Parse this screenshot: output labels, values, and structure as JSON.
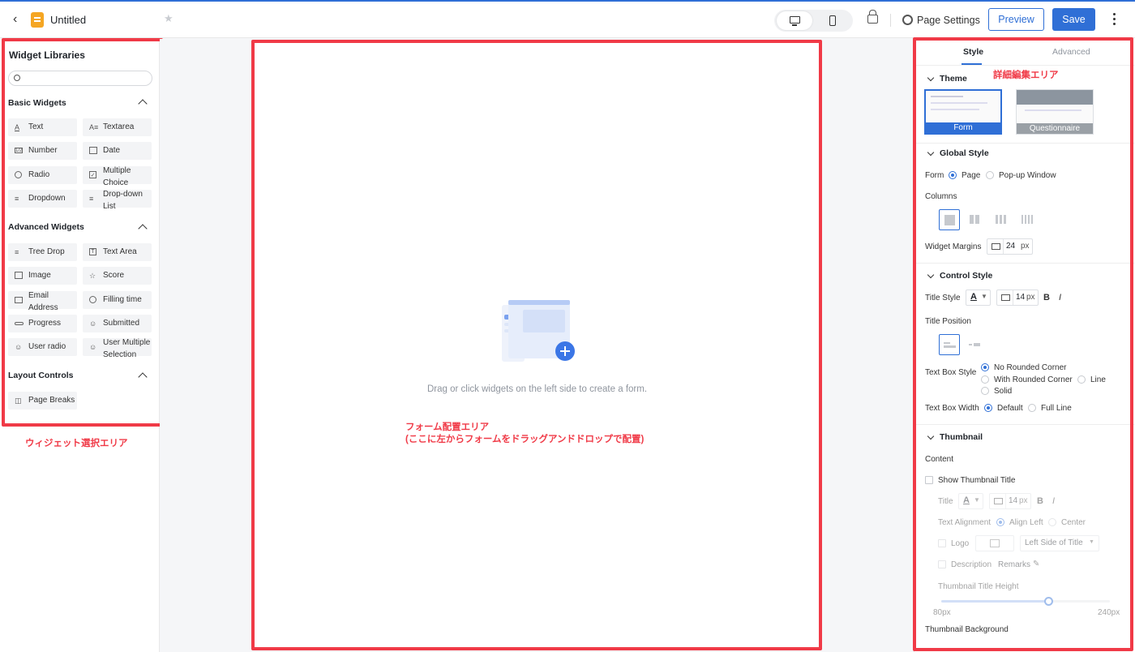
{
  "header": {
    "doc_title": "Untitled",
    "page_settings": "Page Settings",
    "preview": "Preview",
    "save": "Save"
  },
  "left": {
    "title": "Widget Libraries",
    "search_placeholder": "",
    "basic_title": "Basic Widgets",
    "basic": [
      {
        "label": "Text",
        "icon": "A"
      },
      {
        "label": "Textarea",
        "icon": "A="
      },
      {
        "label": "Number",
        "icon": "1/2"
      },
      {
        "label": "Date",
        "icon": "cal"
      },
      {
        "label": "Radio",
        "icon": "radio"
      },
      {
        "label": "Multiple Choice",
        "icon": "check"
      },
      {
        "label": "Dropdown",
        "icon": "list"
      },
      {
        "label": "Drop-down List",
        "icon": "list"
      }
    ],
    "advanced_title": "Advanced Widgets",
    "advanced": [
      {
        "label": "Tree Drop",
        "icon": "tree"
      },
      {
        "label": "Text Area",
        "icon": "T"
      },
      {
        "label": "Image",
        "icon": "image"
      },
      {
        "label": "Score",
        "icon": "star"
      },
      {
        "label": "Email Address",
        "icon": "mail"
      },
      {
        "label": "Filling time",
        "icon": "clock"
      },
      {
        "label": "Progress",
        "icon": "progress"
      },
      {
        "label": "Submitted",
        "icon": "user"
      },
      {
        "label": "User radio",
        "icon": "user"
      },
      {
        "label": "User Multiple Selection",
        "icon": "users"
      }
    ],
    "layout_title": "Layout Controls",
    "layout": [
      {
        "label": "Page Breaks",
        "icon": "pagebreak"
      }
    ],
    "annotation": "ウィジェット選択エリア"
  },
  "center": {
    "empty_text": "Drag or click widgets on the left side to create a form.",
    "annotation_line1": "フォーム配置エリア",
    "annotation_line2": "(ここに左からフォームをドラッグアンドドロップで配置)"
  },
  "right": {
    "tab_style": "Style",
    "tab_advanced": "Advanced",
    "annotation": "詳細編集エリア",
    "theme": {
      "title": "Theme",
      "options": [
        "Form",
        "Questionnaire"
      ]
    },
    "global": {
      "title": "Global Style",
      "form_label": "Form",
      "form_options": [
        "Page",
        "Pop-up Window"
      ],
      "columns_label": "Columns",
      "margins_label": "Widget Margins",
      "margins_value": "24",
      "unit": "px"
    },
    "control": {
      "title": "Control Style",
      "title_style_label": "Title Style",
      "font_size": "14",
      "unit": "px",
      "bold": "B",
      "italic": "I",
      "color_letter": "A",
      "title_position_label": "Title Position",
      "textbox_style_label": "Text Box Style",
      "textbox_options": [
        "No Rounded Corner",
        "With Rounded Corner",
        "Line",
        "Solid"
      ],
      "textbox_width_label": "Text Box Width",
      "width_options": [
        "Default",
        "Full Line"
      ]
    },
    "thumbnail": {
      "title": "Thumbnail",
      "content_label": "Content",
      "show_title": "Show Thumbnail Title",
      "title_label": "Title",
      "font_size": "14",
      "unit": "px",
      "align_label": "Text Alignment",
      "align_options": [
        "Align Left",
        "Center"
      ],
      "logo_label": "Logo",
      "logo_position": "Left Side of Title",
      "description_label": "Description",
      "remarks": "Remarks",
      "height_label": "Thumbnail Title Height",
      "height_min": "80px",
      "height_max": "240px",
      "height_fraction": 0.64,
      "background_label": "Thumbnail Background"
    }
  },
  "colors": {
    "accent": "#2f6fd6",
    "annotation_red": "#f03a47"
  }
}
